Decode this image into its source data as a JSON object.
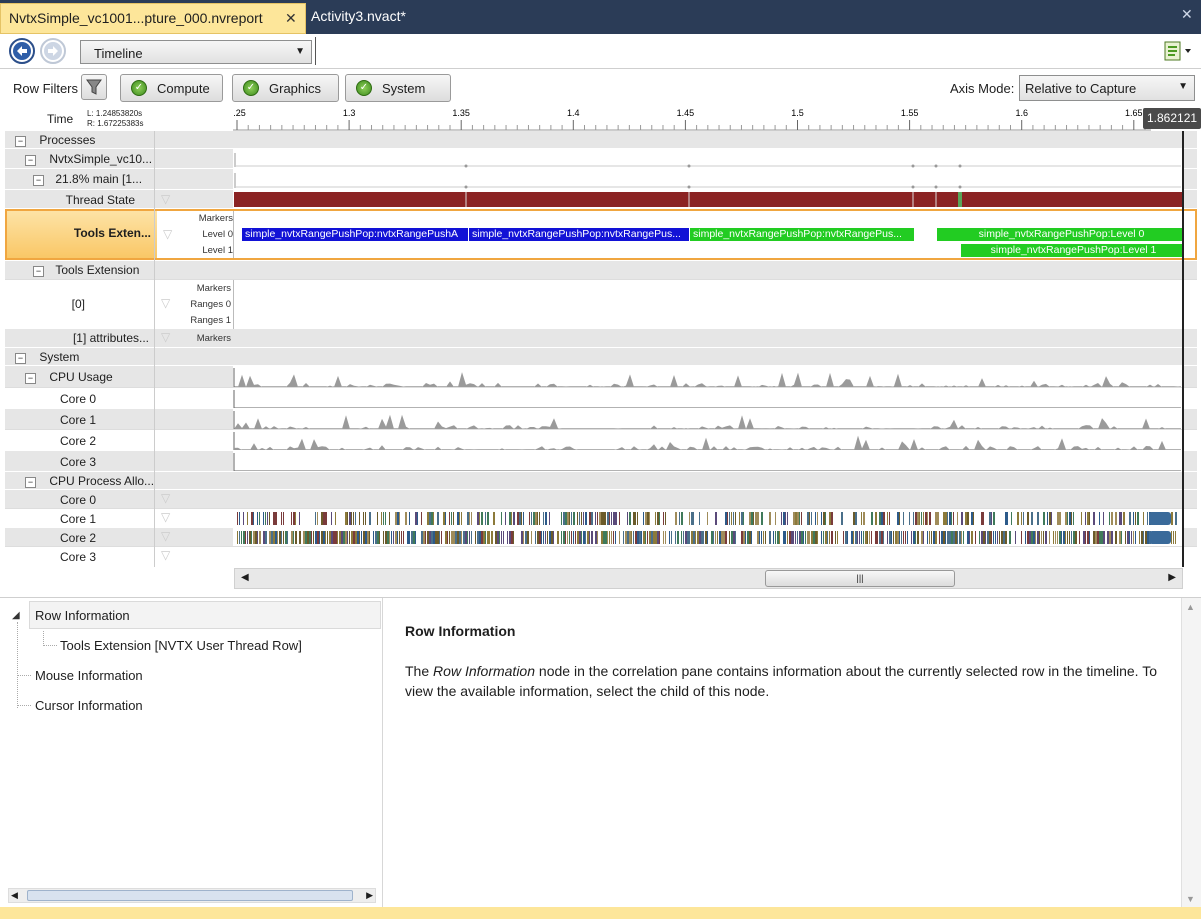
{
  "tabs": {
    "active_label": "NvtxSimple_vc1001...pture_000.nvreport",
    "active_close": "✕",
    "second_label": "Activity3.nvact*",
    "bar_close": "✕"
  },
  "toolbar": {
    "view_select": "Timeline",
    "back_icon": "back-arrow-icon",
    "forward_icon": "forward-arrow-icon"
  },
  "filters": {
    "label": "Row Filters",
    "buttons": [
      "Compute",
      "Graphics",
      "System"
    ],
    "axis_mode_label": "Axis Mode:",
    "axis_mode_value": "Relative to Capture"
  },
  "ruler": {
    "time_label": "Time",
    "left_value": "L: 1.24853820s",
    "right_value": "R: 1.67225383s",
    "ticks": [
      "1.25",
      "1.3",
      "1.35",
      "1.4",
      "1.45",
      "1.5",
      "1.55",
      "1.6",
      "1.65"
    ],
    "cursor_value": "1.862121"
  },
  "rows": {
    "processes": "Processes",
    "process_name": "NvtxSimple_vc10...",
    "thread": "21.8% main [1...",
    "thread_state": "Thread State",
    "tools_ext_selected": "Tools Exten...",
    "tools_ext": "Tools Extension",
    "idx0": "[0]",
    "idx1": "[1]  attributes...",
    "system": "System",
    "cpu_usage": "CPU Usage",
    "cpu_alloc": "CPU  Process Allo...",
    "cores": [
      "Core 0",
      "Core 1",
      "Core 2",
      "Core 3"
    ],
    "sub_markers": "Markers",
    "sub_level0": "Level 0",
    "sub_level1": "Level 1",
    "sub_ranges0": "Ranges 0",
    "sub_ranges1": "Ranges 1"
  },
  "ranges": {
    "level0": [
      "simple_nvtxRangePushPop:nvtxRangePushA",
      "simple_nvtxRangePushPop:nvtxRangePus...",
      "simple_nvtxRangePushPop:nvtxRangePus...",
      "simple_nvtxRangePushPop:Level 0"
    ],
    "level1": [
      "simple_nvtxRangePushPop:Level 1"
    ]
  },
  "colors": {
    "thread_state": "#8b2323",
    "range_blue": "#1010d8",
    "range_green": "#22cc22",
    "selected_row": "#fcd58a",
    "tab_active": "#fde69a"
  },
  "tree": {
    "row_information": "Row Information",
    "tools_extension_row": "Tools Extension [NVTX User Thread Row]",
    "mouse_information": "Mouse Information",
    "cursor_information": "Cursor Information"
  },
  "detail": {
    "title": "Row Information",
    "text_before": "The ",
    "text_em": "Row Information",
    "text_after": " node in the correlation pane contains information about the currently selected row in the timeline. To view the available information, select the child of this node."
  }
}
